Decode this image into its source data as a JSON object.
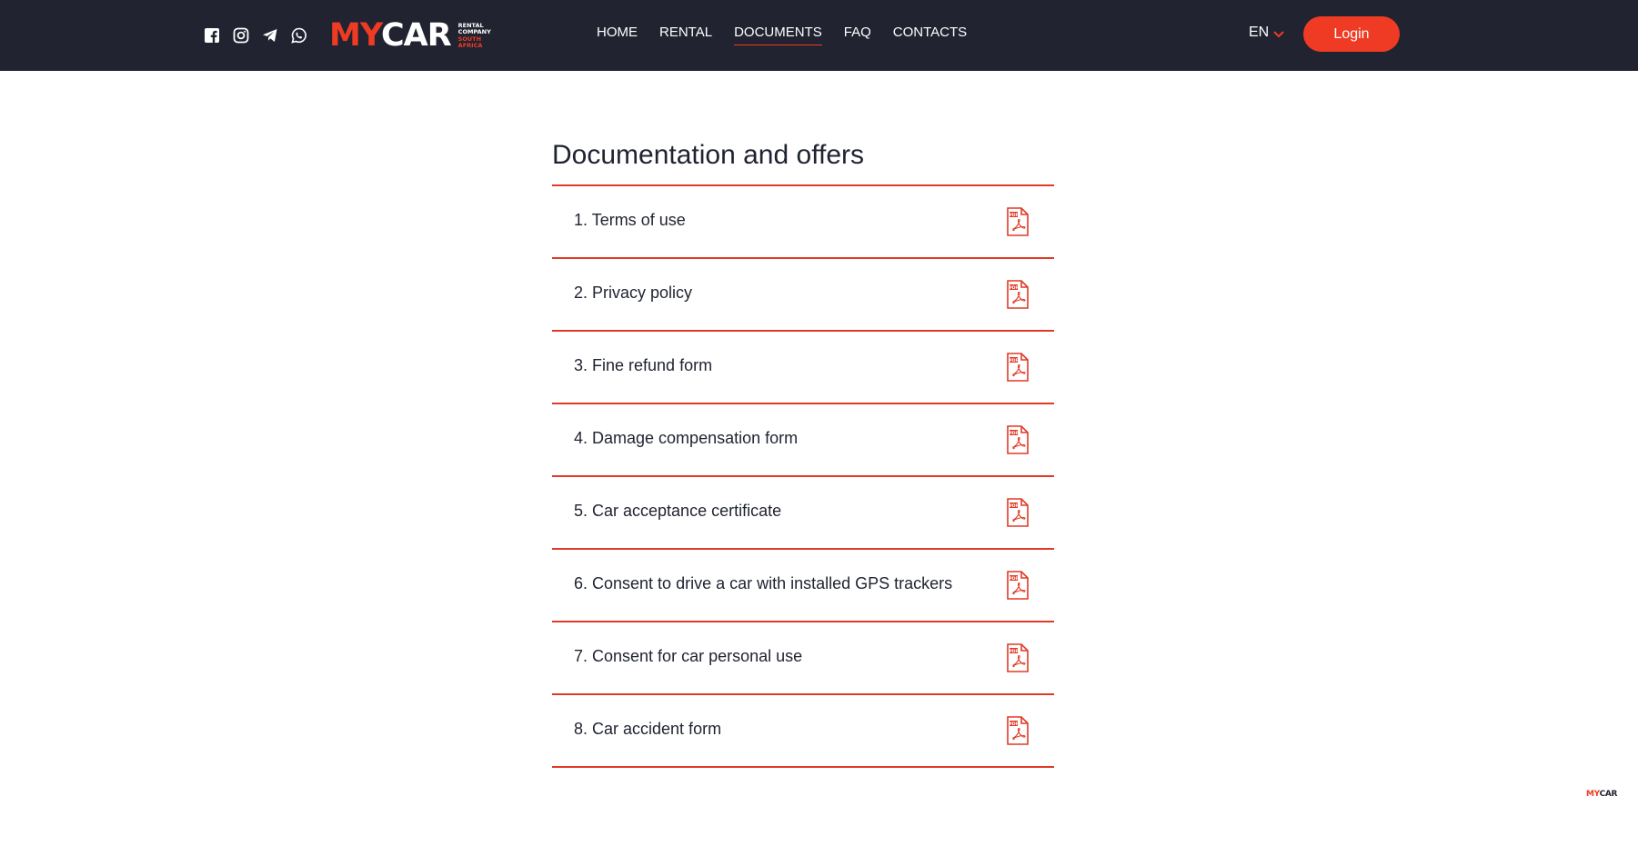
{
  "header": {
    "socials": [
      {
        "icon": "facebook-icon"
      },
      {
        "icon": "instagram-icon"
      },
      {
        "icon": "telegram-icon"
      },
      {
        "icon": "whatsapp-icon"
      }
    ],
    "logo": {
      "part1": "MY",
      "part2": "CAR",
      "sub_line1": "RENTAL",
      "sub_line2": "COMPANY",
      "sub_line3": "SOUTH",
      "sub_line4": "AFRICA"
    },
    "nav": [
      {
        "label": "HOME",
        "active": false
      },
      {
        "label": "RENTAL",
        "active": false
      },
      {
        "label": "DOCUMENTS",
        "active": true
      },
      {
        "label": "FAQ",
        "active": false
      },
      {
        "label": "CONTACTS",
        "active": false
      }
    ],
    "language": "EN",
    "login_label": "Login"
  },
  "main": {
    "title": "Documentation and offers",
    "documents": [
      {
        "label": "1. Terms of use",
        "icon": "pdf-icon"
      },
      {
        "label": "2. Privacy policy",
        "icon": "pdf-icon"
      },
      {
        "label": "3. Fine refund form",
        "icon": "pdf-icon"
      },
      {
        "label": "4. Damage compensation form",
        "icon": "pdf-icon"
      },
      {
        "label": "5. Car acceptance certificate",
        "icon": "pdf-icon"
      },
      {
        "label": "6. Consent to drive a car with installed GPS trackers",
        "icon": "pdf-icon"
      },
      {
        "label": "7. Consent for car personal use",
        "icon": "pdf-icon"
      },
      {
        "label": "8. Car accident form",
        "icon": "pdf-icon"
      }
    ]
  },
  "corner_logo": {
    "part1": "MY",
    "part2": "CAR"
  },
  "colors": {
    "header_bg": "#212331",
    "accent": "#ef3b24",
    "text": "#1f2330",
    "background": "#ffffff"
  }
}
